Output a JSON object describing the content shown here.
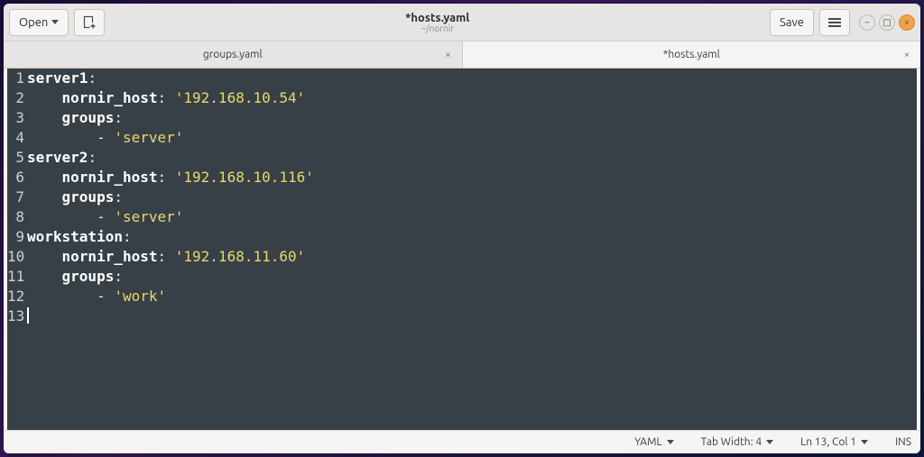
{
  "header": {
    "open_label": "Open",
    "save_label": "Save",
    "title": "*hosts.yaml",
    "subtitle": "~/nornir"
  },
  "tabs": [
    {
      "label": "groups.yaml",
      "active": false
    },
    {
      "label": "*hosts.yaml",
      "active": true
    }
  ],
  "editor": {
    "line_numbers": [
      "1",
      "2",
      "3",
      "4",
      "5",
      "6",
      "7",
      "8",
      "9",
      "10",
      "11",
      "12",
      "13"
    ],
    "lines": [
      [
        {
          "t": "server1",
          "c": "kw"
        },
        {
          "t": ":",
          "c": "pun"
        }
      ],
      [
        {
          "t": "    ",
          "c": "pun"
        },
        {
          "t": "nornir_host",
          "c": "kw"
        },
        {
          "t": ": ",
          "c": "pun"
        },
        {
          "t": "'192.168.10.54'",
          "c": "str"
        }
      ],
      [
        {
          "t": "    ",
          "c": "pun"
        },
        {
          "t": "groups",
          "c": "kw"
        },
        {
          "t": ":",
          "c": "pun"
        }
      ],
      [
        {
          "t": "        - ",
          "c": "pun"
        },
        {
          "t": "'server'",
          "c": "str"
        }
      ],
      [
        {
          "t": "server2",
          "c": "kw"
        },
        {
          "t": ":",
          "c": "pun"
        }
      ],
      [
        {
          "t": "    ",
          "c": "pun"
        },
        {
          "t": "nornir_host",
          "c": "kw"
        },
        {
          "t": ": ",
          "c": "pun"
        },
        {
          "t": "'192.168.10.116'",
          "c": "str"
        }
      ],
      [
        {
          "t": "    ",
          "c": "pun"
        },
        {
          "t": "groups",
          "c": "kw"
        },
        {
          "t": ":",
          "c": "pun"
        }
      ],
      [
        {
          "t": "        - ",
          "c": "pun"
        },
        {
          "t": "'server'",
          "c": "str"
        }
      ],
      [
        {
          "t": "workstation",
          "c": "kw"
        },
        {
          "t": ":",
          "c": "pun"
        }
      ],
      [
        {
          "t": "    ",
          "c": "pun"
        },
        {
          "t": "nornir_host",
          "c": "kw"
        },
        {
          "t": ": ",
          "c": "pun"
        },
        {
          "t": "'192.168.11.60'",
          "c": "str"
        }
      ],
      [
        {
          "t": "    ",
          "c": "pun"
        },
        {
          "t": "groups",
          "c": "kw"
        },
        {
          "t": ":",
          "c": "pun"
        }
      ],
      [
        {
          "t": "        - ",
          "c": "pun"
        },
        {
          "t": "'work'",
          "c": "str"
        }
      ],
      []
    ]
  },
  "statusbar": {
    "language": "YAML",
    "tab_width": "Tab Width: 4",
    "position": "Ln 13, Col 1",
    "mode": "INS"
  }
}
